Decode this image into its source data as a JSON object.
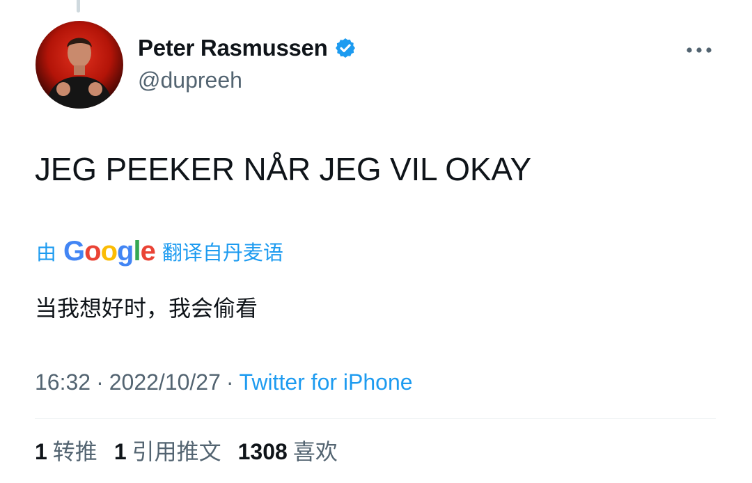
{
  "author": {
    "display_name": "Peter Rasmussen",
    "handle": "@dupreeh",
    "verified": true,
    "avatar_icon": "profile-photo"
  },
  "tweet": {
    "text": "JEG PEEKER NÅR JEG VIL OKAY"
  },
  "translation": {
    "prefix": "由",
    "provider": "Google",
    "suffix": "翻译自丹麦语",
    "text": "当我想好时，我会偷看"
  },
  "meta": {
    "time": "16:32",
    "separator": "·",
    "date": "2022/10/27",
    "source": "Twitter for iPhone"
  },
  "stats": {
    "retweets": {
      "count": "1",
      "label": "转推"
    },
    "quotes": {
      "count": "1",
      "label": "引用推文"
    },
    "likes": {
      "count": "1308",
      "label": "喜欢"
    }
  },
  "colors": {
    "accent": "#1d9bf0",
    "secondary_text": "#536471",
    "primary_text": "#0f1419",
    "google_blue": "#4285F4",
    "google_red": "#EA4335",
    "google_yellow": "#FBBC05",
    "google_green": "#34A853"
  }
}
